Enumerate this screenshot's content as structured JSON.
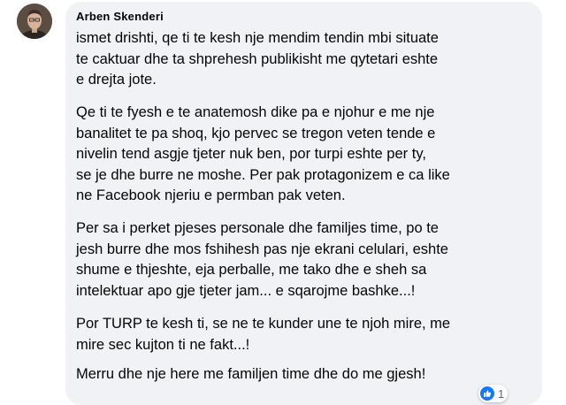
{
  "comment": {
    "author": "Arben Skenderi",
    "paragraphs": [
      [
        "ismet drishti, qe ti te kesh nje mendim tendin mbi situate",
        "te caktuar dhe ta shprehesh publikisht me qytetari eshte",
        "e drejta jote."
      ],
      [
        "Qe ti te fyesh e te anatemosh dike pa e njohur e me nje",
        "banalitet te pa shoq, kjo pervec se tregon veten tende e",
        "nivelin tend asgje tjeter nuk ben, por turpi eshte per ty,",
        "se je dhe burre ne moshe. Per pak protagonizem e ca like",
        "ne Facebook njeriu e permban pak veten."
      ],
      [
        "Per sa i perket pjeses personale dhe familjes time, po te",
        "jesh burre dhe mos fshihesh pas nje ekrani celulari, eshte",
        "shume e thjeshte, eja perballe, me tako dhe e sheh sa",
        "intelektuar apo gje tjeter jam... e sqarojme bashke...!"
      ],
      [
        "Por TURP te kesh ti, se ne te kunder une te njoh mire, me",
        "mire sec kujton ti ne fakt...!"
      ],
      [
        "Merru dhe nje here me familjen time dhe do me gjesh!"
      ]
    ],
    "reactions": {
      "icon": "like-icon",
      "count": "1",
      "color": "#1877f2"
    }
  },
  "colors": {
    "bubble_bg": "#f0f2f5",
    "text": "#050505",
    "muted": "#65676b"
  }
}
